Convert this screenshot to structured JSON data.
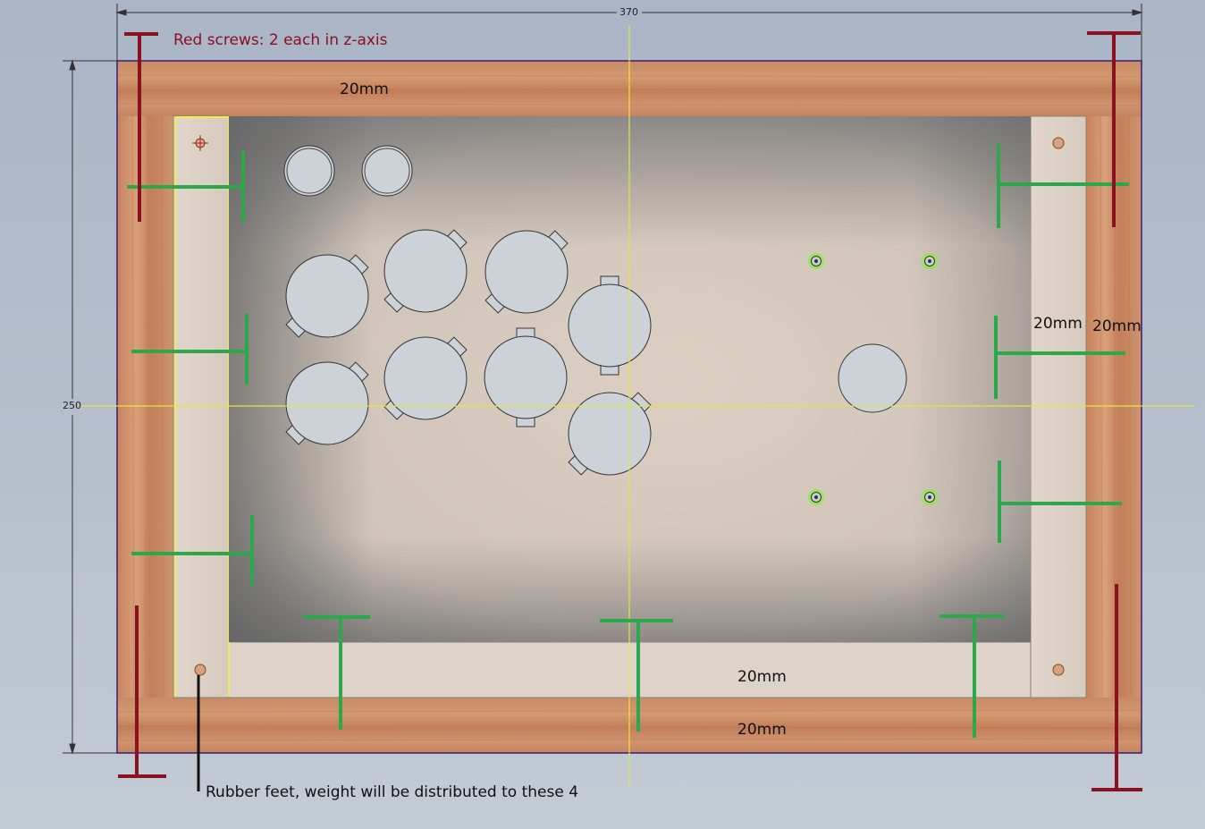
{
  "drawing": {
    "width_dimension": "370",
    "height_dimension": "250"
  },
  "labels": {
    "top_frame": "20mm",
    "right_inner": "20mm",
    "right_outer": "20mm",
    "bottom_inner": "20mm",
    "bottom_outer": "20mm"
  },
  "notes": {
    "red_screws": "Red screws: 2 each in z-axis",
    "rubber_feet": "Rubber feet, weight will be distributed to these 4"
  },
  "colors": {
    "screw_red": "#8b1020",
    "joint_green": "#22aa44",
    "panel": "#d9d1c8",
    "wood": "#c9835c",
    "button": "#ccd2d7",
    "axis": "#e8e840",
    "outline": "#3b1c6e"
  }
}
